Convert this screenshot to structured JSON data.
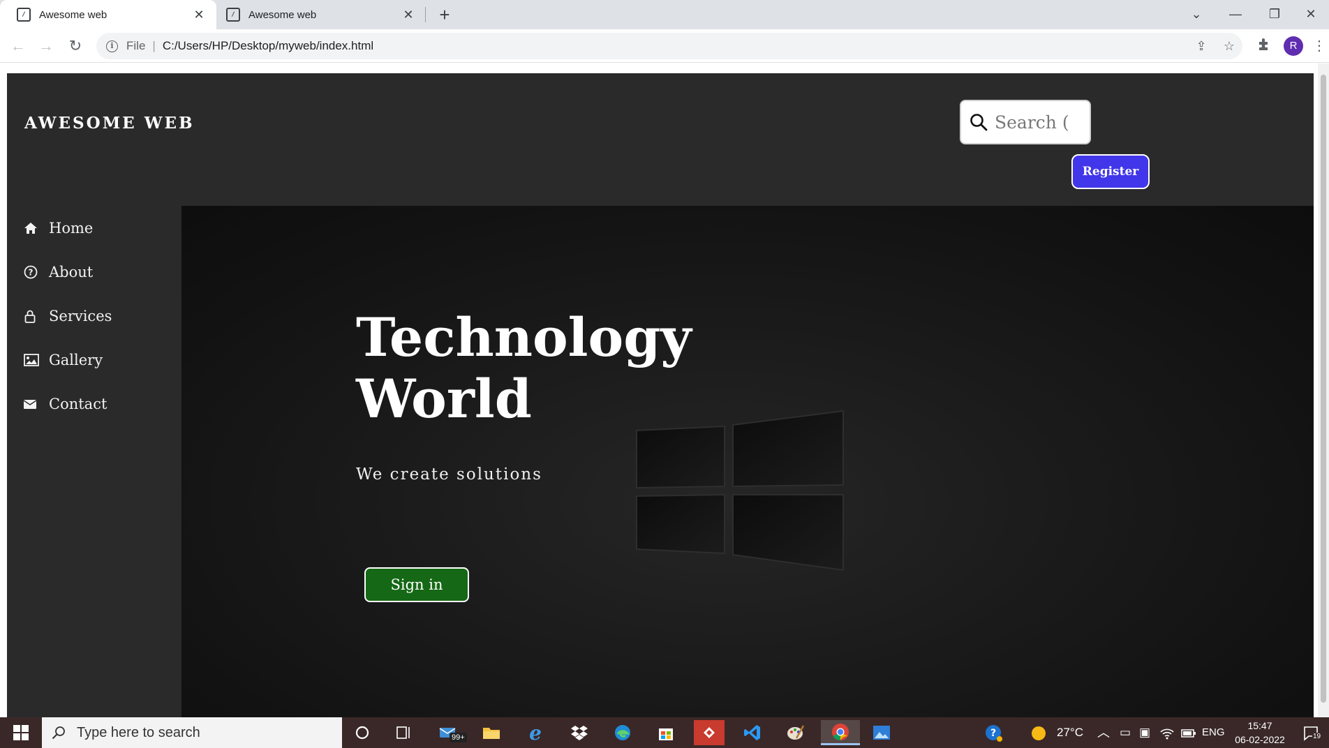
{
  "browser": {
    "tabs": [
      {
        "title": "Awesome web",
        "active": true
      },
      {
        "title": "Awesome web",
        "active": false
      }
    ],
    "new_tab_icon": "plus-icon",
    "url_scheme": "File",
    "url": "C:/Users/HP/Desktop/myweb/index.html",
    "profile_initial": "R"
  },
  "site": {
    "brand": "AWESOME WEB",
    "search_placeholder": "Search (",
    "register_label": "Register",
    "sidebar": [
      {
        "label": "Home",
        "icon": "home-icon"
      },
      {
        "label": "About",
        "icon": "question-circle-icon"
      },
      {
        "label": "Services",
        "icon": "lock-icon"
      },
      {
        "label": "Gallery",
        "icon": "image-icon"
      },
      {
        "label": "Contact",
        "icon": "envelope-icon"
      }
    ],
    "hero": {
      "title_line1": "Technology",
      "title_line2": "World",
      "subtitle": "We create solutions",
      "signin_label": "Sign in"
    }
  },
  "taskbar": {
    "search_placeholder": "Type here to search",
    "mail_badge": "99+",
    "weather": "27°C",
    "language": "ENG",
    "time": "15:47",
    "date": "06-02-2022",
    "notifications": "19"
  },
  "colors": {
    "register_bg": "#4236ea",
    "signin_bg": "#156815",
    "header_bg": "#2a2a2b"
  }
}
